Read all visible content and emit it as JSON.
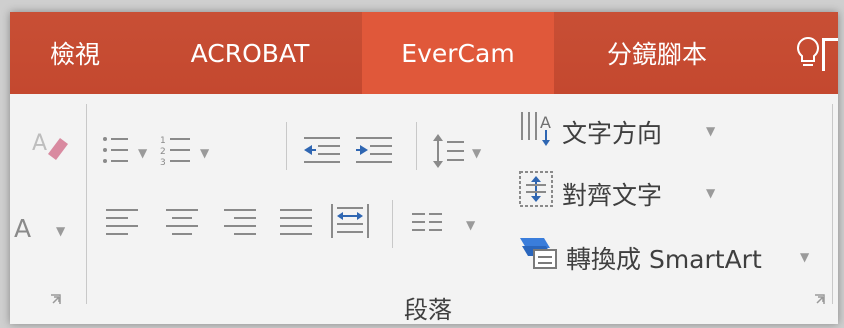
{
  "tabs": [
    {
      "label": "檢視",
      "active": false
    },
    {
      "label": "ACROBAT",
      "active": false
    },
    {
      "label": "EverCam",
      "active": true
    },
    {
      "label": "分鏡腳本",
      "active": false
    }
  ],
  "ribbon": {
    "text_direction_label": "文字方向",
    "align_text_label": "對齊文字",
    "smartart_label": "轉換成 SmartArt",
    "group_label": "段落"
  },
  "colors": {
    "tab_bar": "#c74b32",
    "active_tab": "#e0583a",
    "ribbon_bg": "#f3f3f3",
    "icon_gray": "#7a7a7a",
    "text": "#3f3f3f"
  },
  "icons": [
    "clear-formatting-icon",
    "font-size-icon",
    "bullets-icon",
    "numbering-icon",
    "decrease-indent-icon",
    "increase-indent-icon",
    "line-spacing-icon",
    "text-direction-icon",
    "align-text-icon",
    "smartart-icon",
    "align-left-icon",
    "align-center-icon",
    "align-right-icon",
    "justify-icon",
    "distributed-icon",
    "columns-icon",
    "dialog-launcher-icon",
    "lightbulb-icon"
  ]
}
